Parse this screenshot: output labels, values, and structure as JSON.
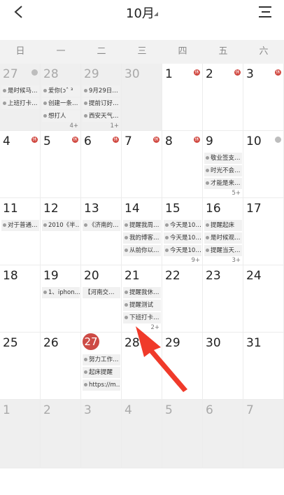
{
  "header": {
    "title": "10月",
    "back_icon": "chevron-left-icon",
    "menu_icon": "menu-icon"
  },
  "weekdays": [
    "日",
    "一",
    "二",
    "三",
    "四",
    "五",
    "六"
  ],
  "weeks": [
    [
      {
        "day": "27",
        "other": true,
        "badge": "grey",
        "events": [
          "是时候马…",
          "上班打卡…"
        ]
      },
      {
        "day": "28",
        "other": true,
        "events": [
          "爱你(ɔˆ ³",
          "创建一条…",
          "想打人"
        ],
        "more": "4+"
      },
      {
        "day": "29",
        "other": true,
        "events": [
          "9月29日…",
          "提前订好…",
          "西安天气…"
        ],
        "more": "1+"
      },
      {
        "day": "30",
        "other": true,
        "events": []
      },
      {
        "day": "1",
        "badge": "red",
        "badge_text": "休",
        "events": []
      },
      {
        "day": "2",
        "badge": "red",
        "badge_text": "休",
        "events": []
      },
      {
        "day": "3",
        "badge": "red",
        "badge_text": "休",
        "events": []
      }
    ],
    [
      {
        "day": "4",
        "badge": "red",
        "badge_text": "休",
        "events": []
      },
      {
        "day": "5",
        "badge": "red",
        "badge_text": "休",
        "events": []
      },
      {
        "day": "6",
        "badge": "red",
        "badge_text": "休",
        "events": []
      },
      {
        "day": "7",
        "badge": "red",
        "badge_text": "休",
        "events": []
      },
      {
        "day": "8",
        "badge": "red",
        "badge_text": "休",
        "events": []
      },
      {
        "day": "9",
        "events": [
          "敬业签支…",
          "时光不会…",
          "才能是来…"
        ],
        "more": "5+"
      },
      {
        "day": "10",
        "badge": "grey",
        "events": []
      }
    ],
    [
      {
        "day": "11",
        "events": [
          "对于普通…"
        ]
      },
      {
        "day": "12",
        "events": [
          "2010《半…"
        ]
      },
      {
        "day": "13",
        "events": [
          "《济南的…"
        ]
      },
      {
        "day": "14",
        "events": [
          "提醒我周…",
          "我的博客…",
          "从前你以…"
        ]
      },
      {
        "day": "15",
        "events": [
          "今天是10…",
          "今天是10…",
          "今天是10…"
        ],
        "more": "9+"
      },
      {
        "day": "16",
        "events": [
          "提醒起床",
          "是时候观…",
          "提醒当天…"
        ],
        "more": "3+"
      },
      {
        "day": "17",
        "events": []
      }
    ],
    [
      {
        "day": "18",
        "events": []
      },
      {
        "day": "19",
        "events": [
          "1、iphon…"
        ]
      },
      {
        "day": "20",
        "events": [
          "【河南交…"
        ],
        "plain_first": true
      },
      {
        "day": "21",
        "events": [
          "提醒我休…",
          "提醒测试",
          "下班打卡…"
        ],
        "more": "2+"
      },
      {
        "day": "22",
        "events": []
      },
      {
        "day": "23",
        "events": []
      },
      {
        "day": "24",
        "events": []
      }
    ],
    [
      {
        "day": "25",
        "events": []
      },
      {
        "day": "26",
        "events": []
      },
      {
        "day": "27",
        "today": true,
        "events": [
          "努力工作…",
          "起床提醒",
          "https://m…"
        ]
      },
      {
        "day": "28",
        "events": []
      },
      {
        "day": "29",
        "events": []
      },
      {
        "day": "30",
        "events": []
      },
      {
        "day": "31",
        "events": []
      }
    ],
    [
      {
        "day": "1",
        "other": true,
        "events": []
      },
      {
        "day": "2",
        "other": true,
        "events": []
      },
      {
        "day": "3",
        "other": true,
        "events": []
      },
      {
        "day": "4",
        "other": true,
        "events": []
      },
      {
        "day": "5",
        "other": true,
        "events": []
      },
      {
        "day": "6",
        "other": true,
        "events": []
      },
      {
        "day": "7",
        "other": true,
        "events": []
      }
    ]
  ],
  "colors": {
    "accent": "#cd4a45",
    "arrow": "#f03a2a"
  }
}
